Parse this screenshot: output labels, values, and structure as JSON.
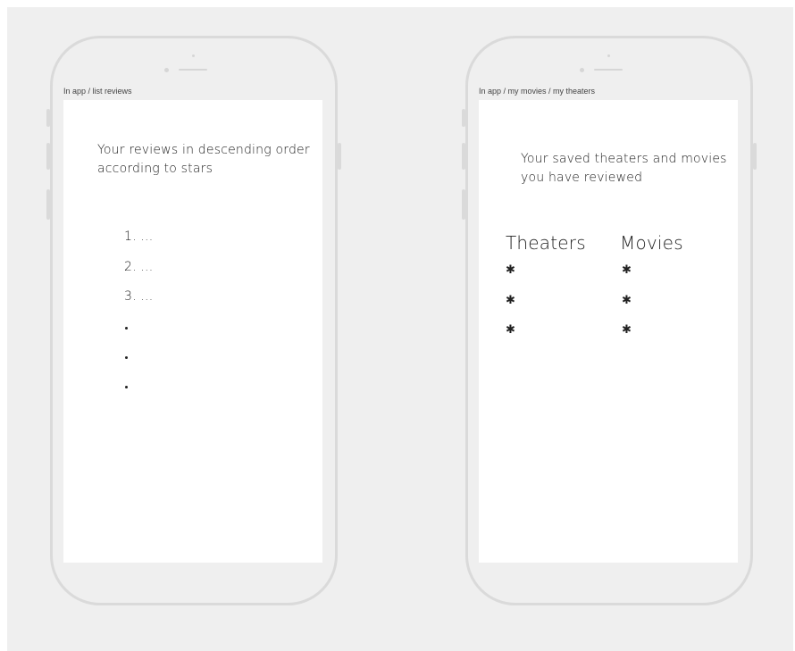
{
  "screens": [
    {
      "label": "In app / list reviews",
      "heading": "Your reviews in descending order according to stars",
      "list": [
        "1. ...",
        "2. ...",
        "3. ..."
      ]
    },
    {
      "label": "In app / my movies / my theaters",
      "heading": "Your saved theaters and movies you have reviewed",
      "columns": [
        "Theaters",
        "Movies"
      ],
      "bullet_glyph": "✱"
    }
  ]
}
